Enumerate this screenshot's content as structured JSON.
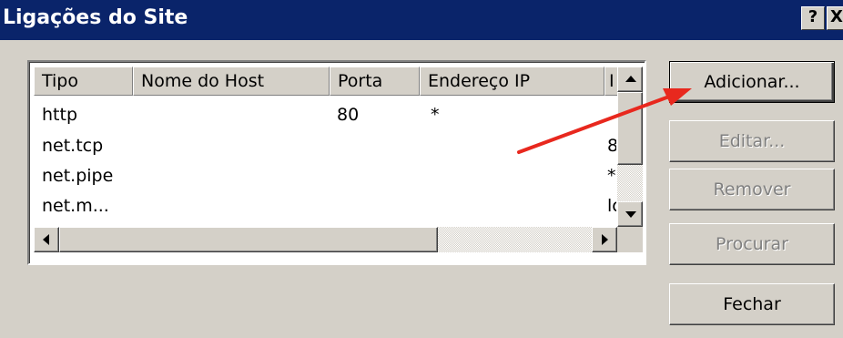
{
  "window": {
    "title": "Ligações do Site",
    "help_label": "?",
    "close_label": "X"
  },
  "list": {
    "columns": [
      "Tipo",
      "Nome do Host",
      "Porta",
      "Endereço IP",
      "I"
    ],
    "rows": [
      {
        "tipo": "http",
        "host": "",
        "porta": "80",
        "ip": "*",
        "extra": ""
      },
      {
        "tipo": "net.tcp",
        "host": "",
        "porta": "",
        "ip": "",
        "extra": "8"
      },
      {
        "tipo": "net.pipe",
        "host": "",
        "porta": "",
        "ip": "",
        "extra": "*"
      },
      {
        "tipo": "net.m...",
        "host": "",
        "porta": "",
        "ip": "",
        "extra": "lc"
      }
    ]
  },
  "buttons": {
    "add": "Adicionar...",
    "edit": "Editar...",
    "remove": "Remover",
    "browse": "Procurar",
    "close": "Fechar"
  },
  "colors": {
    "titlebar": "#0a246a",
    "dialog_bg": "#d4d0c8",
    "annotation_arrow": "#e8281e"
  },
  "icons": {
    "help": "help-icon",
    "close": "close-icon",
    "scroll_up": "arrow-up-icon",
    "scroll_down": "arrow-down-icon",
    "scroll_left": "arrow-left-icon",
    "scroll_right": "arrow-right-icon"
  }
}
